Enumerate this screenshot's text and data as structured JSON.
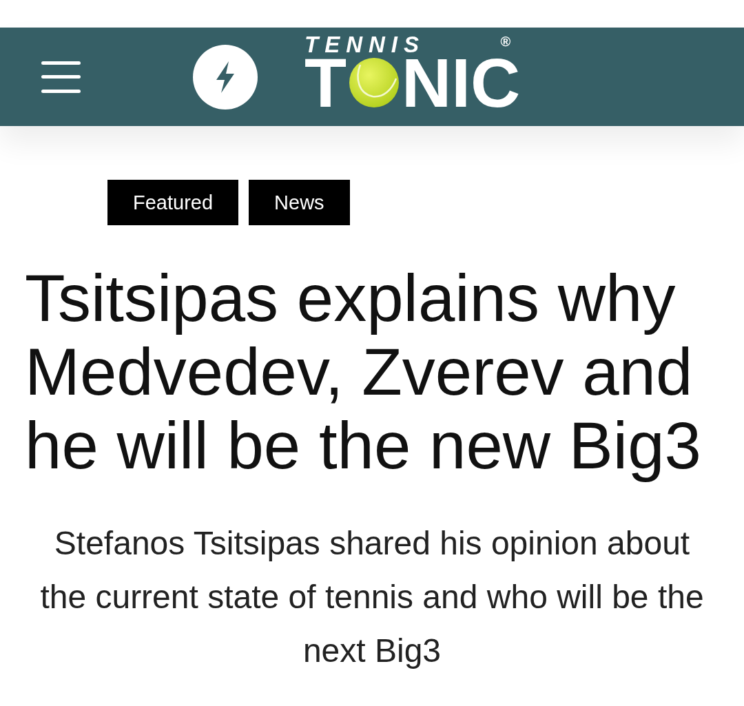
{
  "header": {
    "logo": {
      "top_word": "TENNIS",
      "word_start": "T",
      "word_end": "NIC",
      "registered_mark": "®"
    }
  },
  "article": {
    "tags": [
      {
        "label": "Featured"
      },
      {
        "label": "News"
      }
    ],
    "title": "Tsitsipas explains why Medvedev, Zverev and he will be the new Big3",
    "subtitle": "Stefanos Tsitsipas shared his opinion about the current state of tennis and who will be the next Big3"
  }
}
